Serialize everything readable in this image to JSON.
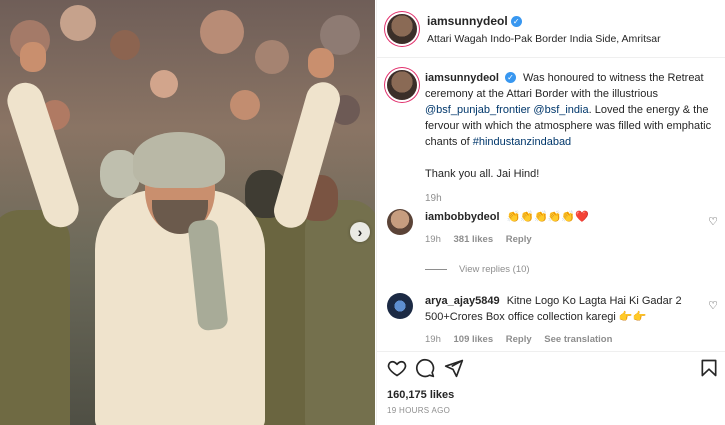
{
  "post": {
    "author": "iamsunnydeol",
    "location": "Attari Wagah Indo-Pak Border India Side, Amritsar",
    "caption_part1": "Was honoured to witness the Retreat ceremony at the Attari Border with the illustrious ",
    "mention1": "@bsf_punjab_frontier",
    "mention2": "@bsf_india",
    "caption_part2": ". Loved the energy & the fervour with which the atmosphere was filled with emphatic chants of ",
    "hashtag": "#hindustanzindabad",
    "caption_thanks": "Thank you all. Jai Hind!",
    "caption_time": "19h",
    "likes": "160,175 likes",
    "posted_ago": "19 HOURS AGO"
  },
  "comments": [
    {
      "username": "iambobbydeol",
      "text": "👏👏👏👏👏❤️",
      "time": "19h",
      "likes": "381 likes",
      "reply": "Reply",
      "view_replies": "View replies (10)"
    },
    {
      "username": "arya_ajay5849",
      "text": "Kitne Logo Ko Lagta Hai Ki Gadar 2 500+Crores Box office collection karegi 👉👉",
      "time": "19h",
      "likes": "109 likes",
      "reply": "Reply",
      "translation": "See translation"
    }
  ],
  "icons": {
    "verified": "verified-badge-icon",
    "like": "heart-icon",
    "comment": "comment-icon",
    "share": "share-icon",
    "save": "bookmark-icon",
    "next": "chevron-right-icon"
  },
  "colors": {
    "link": "#00376b",
    "verified": "#3897f0",
    "muted": "#8e8e8e"
  }
}
